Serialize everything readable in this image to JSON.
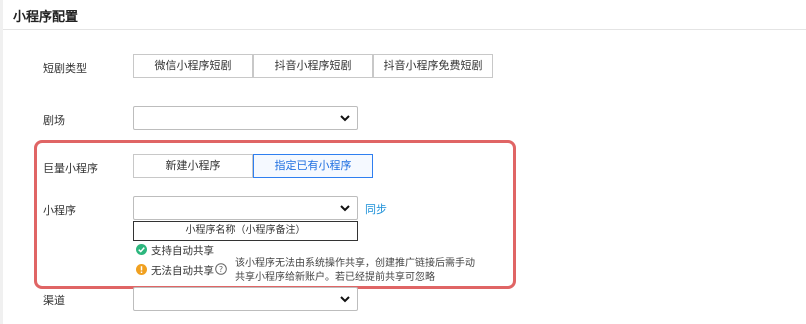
{
  "header": {
    "title": "小程序配置"
  },
  "drama_type": {
    "label": "短剧类型",
    "options": [
      "微信小程序短剧",
      "抖音小程序短剧",
      "抖音小程序免费短剧"
    ]
  },
  "theater": {
    "label": "剧场",
    "value": ""
  },
  "giant": {
    "label": "巨量小程序",
    "options": [
      "新建小程序",
      "指定已有小程序"
    ],
    "selected": "指定已有小程序"
  },
  "mini_program": {
    "label": "小程序",
    "value": "",
    "sync_label": "同步",
    "name_field": "小程序名称（小程序备注）",
    "auto_share_yes": "支持自动共享",
    "auto_share_no": "无法自动共享",
    "note": "该小程序无法由系统操作共享，创建推广链接后需手动共享小程序给新账户。若已经提前共享可忽略"
  },
  "channel": {
    "label": "渠道",
    "value": ""
  },
  "colors": {
    "accent": "#2f7ff0",
    "highlight": "#e06565",
    "success": "#2cb67d",
    "warning": "#f0a020",
    "link": "#1a8fd8"
  }
}
